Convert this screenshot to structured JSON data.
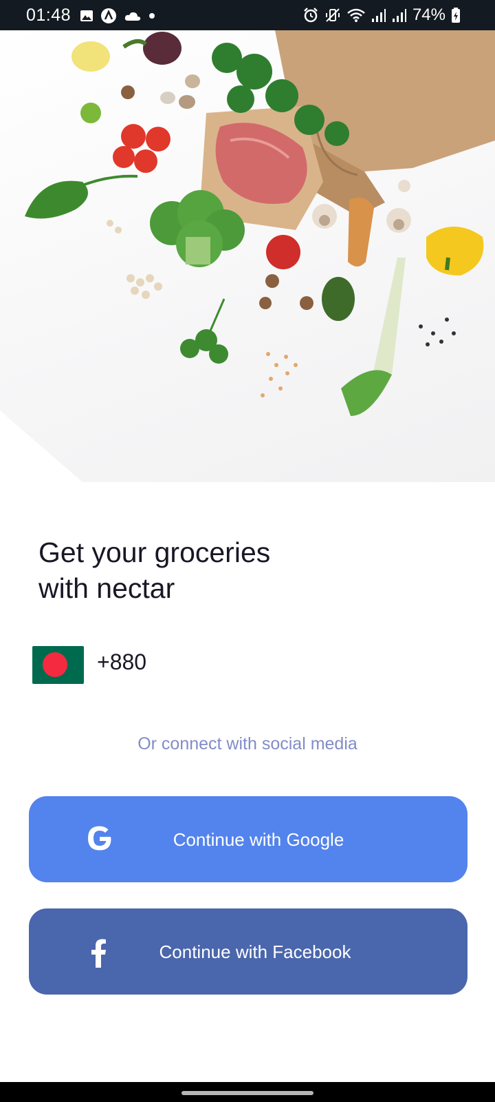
{
  "status_bar": {
    "time": "01:48",
    "battery": "74%",
    "left_icons": [
      "gallery-icon",
      "app-icon",
      "cloud-icon",
      "dot-icon"
    ],
    "right_icons": [
      "alarm-icon",
      "vibrate-icon",
      "wifi-icon",
      "signal-icon",
      "signal-icon",
      "battery-icon"
    ]
  },
  "hero": {
    "image": "groceries-photo"
  },
  "headline": {
    "line1": "Get your groceries",
    "line2": "with nectar"
  },
  "phone": {
    "country_flag": "bangladesh-flag",
    "code": "+880"
  },
  "social": {
    "label": "Or connect with social media"
  },
  "buttons": {
    "google": {
      "label": "Continue with Google",
      "color": "#5383ec",
      "icon": "google-icon"
    },
    "facebook": {
      "label": "Continue with Facebook",
      "color": "#4a66ac",
      "icon": "facebook-icon"
    }
  },
  "colors": {
    "title": "#181725",
    "social_label": "#828cc8",
    "status_bar": "#141a21"
  }
}
